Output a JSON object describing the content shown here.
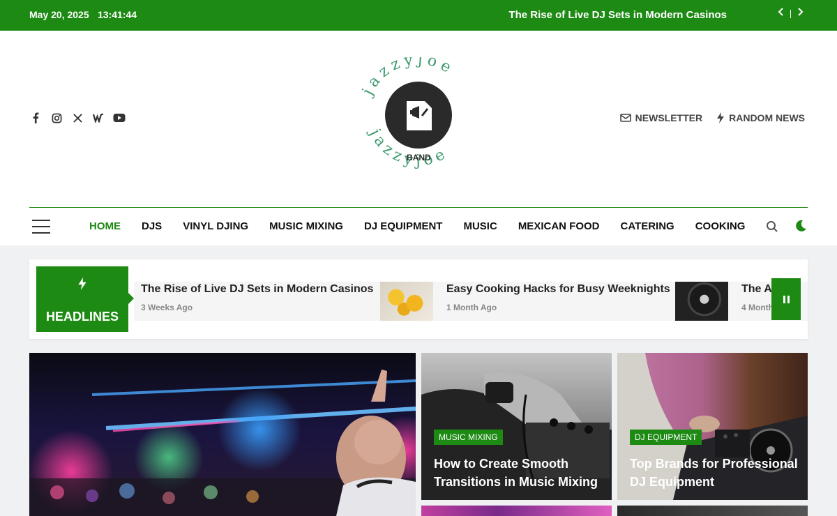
{
  "topbar": {
    "date": "May 20, 2025",
    "time": "13:41:44",
    "ticker": "The Rise of Live DJ Sets in Modern Casinos"
  },
  "header": {
    "social_icons": [
      "facebook-icon",
      "instagram-icon",
      "x-icon",
      "wordpress-icon",
      "youtube-icon"
    ],
    "logo": {
      "ring_text": "jazzyjoe",
      "badge": "BAND"
    },
    "newsletter_label": "NEWSLETTER",
    "random_news_label": "RANDOM NEWS"
  },
  "nav": {
    "items": [
      "HOME",
      "DJS",
      "VINYL DJING",
      "MUSIC MIXING",
      "DJ EQUIPMENT",
      "MUSIC",
      "MEXICAN FOOD",
      "CATERING",
      "COOKING"
    ],
    "active_index": 0
  },
  "headlines": {
    "label": "HEADLINES",
    "items": [
      {
        "title": "The Rise of Live DJ Sets in Modern Casinos",
        "date": "3 Weeks Ago"
      },
      {
        "title": "Easy Cooking Hacks for Busy Weeknights",
        "date": "1 Month Ago"
      },
      {
        "title": "The A",
        "date": "4 Month"
      }
    ]
  },
  "cards": [
    {
      "category": "MUSIC MIXING",
      "title": "How to Create Smooth Transitions in Music Mixing"
    },
    {
      "category": "DJ EQUIPMENT",
      "title": "Top Brands for Professional DJ Equipment"
    }
  ],
  "colors": {
    "accent": "#1d8a14",
    "text": "#222222",
    "background": "#f0f1f3"
  }
}
